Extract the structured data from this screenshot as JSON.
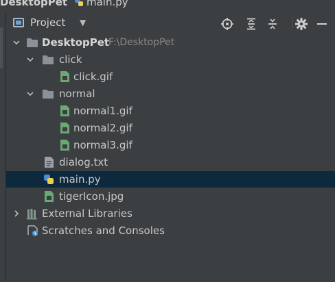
{
  "topbar": {
    "crumb": "DesktopPet",
    "file": "main.py"
  },
  "panel": {
    "title": "Project",
    "toolbar_icons": [
      "locate-icon",
      "expand-all-icon",
      "collapse-all-icon",
      "gear-icon",
      "minimize-icon"
    ]
  },
  "tree": {
    "root": {
      "label": "DesktopPet",
      "path": "F:\\DesktopPet"
    },
    "click_folder": {
      "label": "click"
    },
    "click_gif": {
      "label": "click.gif"
    },
    "normal_folder": {
      "label": "normal"
    },
    "normal1": {
      "label": "normal1.gif"
    },
    "normal2": {
      "label": "normal2.gif"
    },
    "normal3": {
      "label": "normal3.gif"
    },
    "dialog": {
      "label": "dialog.txt"
    },
    "main": {
      "label": "main.py"
    },
    "tiger": {
      "label": "tigerIcon.jpg"
    },
    "external": {
      "label": "External Libraries"
    },
    "scratches": {
      "label": "Scratches and Consoles"
    }
  },
  "colors": {
    "panel_bg": "#3c3f41",
    "selection": "#0d293e",
    "folder": "#8a9199",
    "image_file": "#6aa874",
    "python_blue": "#4a8bd1",
    "python_yellow": "#f0d050"
  }
}
